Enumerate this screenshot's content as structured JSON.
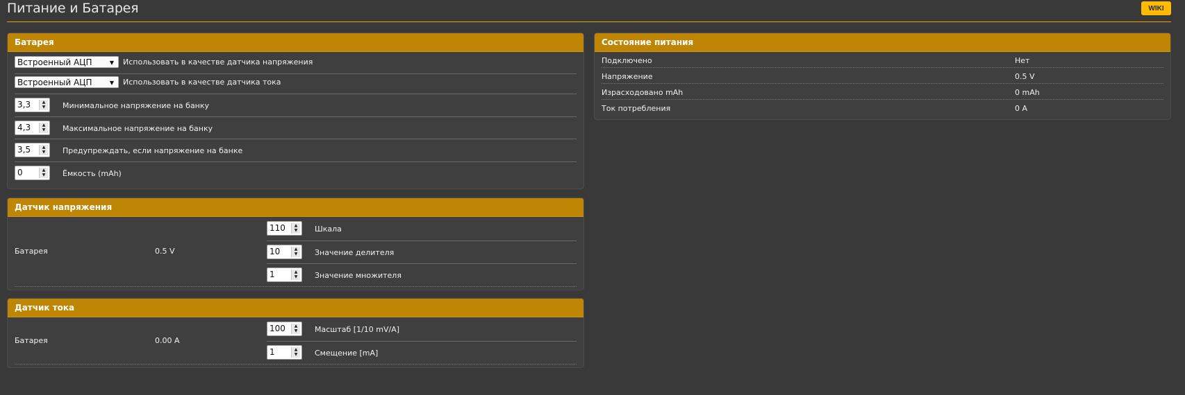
{
  "header": {
    "title": "Питание и Батарея",
    "wiki_label": "WIKI"
  },
  "battery": {
    "title": "Батарея",
    "voltage_source": {
      "value": "Встроенный АЦП",
      "label": "Использовать в качестве датчика напряжения"
    },
    "current_source": {
      "value": "Встроенный АЦП",
      "label": "Использовать в качестве датчика тока"
    },
    "min_cell": {
      "value": "3,3",
      "label": "Минимальное напряжение на банку"
    },
    "max_cell": {
      "value": "4,3",
      "label": "Максимальное напряжение на банку"
    },
    "warn_cell": {
      "value": "3,5",
      "label": "Предупреждать, если напряжение на банке"
    },
    "capacity": {
      "value": "0",
      "label": "Ёмкость (mAh)"
    }
  },
  "voltage_meter": {
    "title": "Датчик напряжения",
    "name": "Батарея",
    "reading": "0.5 V",
    "scale": {
      "value": "110",
      "label": "Шкала"
    },
    "divider": {
      "value": "10",
      "label": "Значение делителя"
    },
    "multiplier": {
      "value": "1",
      "label": "Значение множителя"
    }
  },
  "current_meter": {
    "title": "Датчик тока",
    "name": "Батарея",
    "reading": "0.00 A",
    "scale": {
      "value": "100",
      "label": "Масштаб [1/10 mV/A]"
    },
    "offset": {
      "value": "1",
      "label": "Смещение [mA]"
    }
  },
  "power_state": {
    "title": "Состояние питания",
    "rows": [
      {
        "label": "Подключено",
        "value": "Нет"
      },
      {
        "label": "Напряжение",
        "value": "0.5 V"
      },
      {
        "label": "Израсходовано mAh",
        "value": "0 mAh"
      },
      {
        "label": "Ток потребления",
        "value": "0 A"
      }
    ]
  },
  "colors": {
    "accent": "#bf8505",
    "wiki": "#ffbb00",
    "background": "#393939",
    "panel": "#3f3f3f"
  },
  "icons": {
    "dropdown": "caret-down-icon",
    "spinner": "up-down-arrows-icon"
  }
}
